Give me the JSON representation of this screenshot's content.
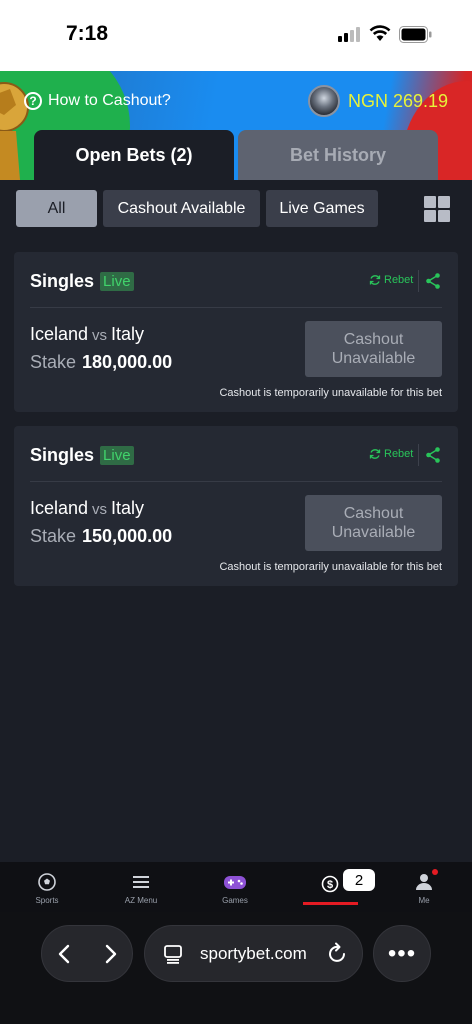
{
  "status_bar": {
    "time": "7:18"
  },
  "header": {
    "help_label": "How to Cashout?",
    "balance": "NGN 269.19",
    "tabs": [
      {
        "label": "Open Bets (2)",
        "active": true
      },
      {
        "label": "Bet History",
        "active": false
      }
    ]
  },
  "filters": {
    "items": [
      {
        "label": "All",
        "active": true
      },
      {
        "label": "Cashout Available",
        "active": false
      },
      {
        "label": "Live Games",
        "active": false
      }
    ]
  },
  "bets": [
    {
      "type": "Singles",
      "live_label": "Live",
      "rebet_label": "Rebet",
      "home": "Iceland",
      "vs": "vs",
      "away": "Italy",
      "stake_label": "Stake",
      "stake": "180,000.00",
      "cashout_line1": "Cashout",
      "cashout_line2": "Unavailable",
      "note": "Cashout is temporarily unavailable for this bet"
    },
    {
      "type": "Singles",
      "live_label": "Live",
      "rebet_label": "Rebet",
      "home": "Iceland",
      "vs": "vs",
      "away": "Italy",
      "stake_label": "Stake",
      "stake": "150,000.00",
      "cashout_line1": "Cashout",
      "cashout_line2": "Unavailable",
      "note": "Cashout is temporarily unavailable for this bet"
    }
  ],
  "bottom_nav": {
    "items": [
      {
        "label": "Sports",
        "icon": "soccer-ball-icon"
      },
      {
        "label": "AZ Menu",
        "icon": "menu-icon"
      },
      {
        "label": "Games",
        "icon": "gamepad-icon"
      },
      {
        "label": "",
        "icon": "betslip-icon"
      },
      {
        "label": "Me",
        "icon": "person-icon"
      }
    ],
    "betslip_count": "2"
  },
  "browser": {
    "url": "sportybet.com",
    "more": "•••"
  },
  "colors": {
    "background": "#1b1e26",
    "card": "#252933",
    "accent_green": "#29c45a",
    "balance_yellow": "#e8f23a",
    "nav_active_red": "#e41b23"
  }
}
